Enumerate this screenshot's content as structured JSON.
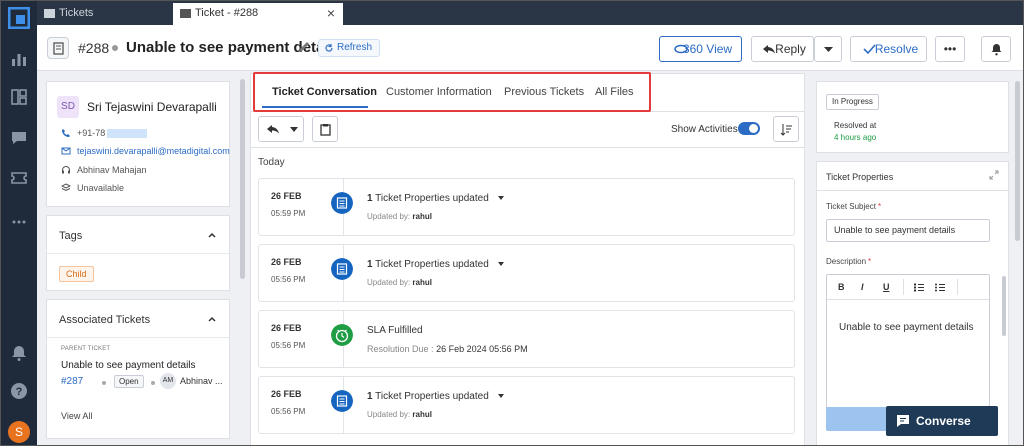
{
  "browser_tabs": [
    {
      "label": "Tickets"
    },
    {
      "label": "Ticket - #288"
    }
  ],
  "header": {
    "ticket_id": "#288",
    "title": "Unable to see payment details",
    "refresh_label": "Refresh",
    "view360_label": "360 View",
    "reply_label": "Reply",
    "resolve_label": "Resolve",
    "more_label": "•••"
  },
  "contact": {
    "initials": "SD",
    "name": "Sri Tejaswini Devarapalli",
    "phone": "+91-78",
    "email": "tejaswini.devarapalli@metadigital.com",
    "agent": "Abhinav Mahajan",
    "availability": "Unavailable"
  },
  "tags": {
    "heading": "Tags",
    "items": [
      "Child"
    ]
  },
  "associated": {
    "heading": "Associated Tickets",
    "parent_label": "PARENT TICKET",
    "title": "Unable to see payment details",
    "id": "#287",
    "status": "Open",
    "agent_initials": "AM",
    "agent_name": "Abhinav ...",
    "view_all": "View All"
  },
  "content_tabs": [
    {
      "label": "Ticket Conversation",
      "active": true
    },
    {
      "label": "Customer Information",
      "active": false
    },
    {
      "label": "Previous Tickets",
      "active": false
    },
    {
      "label": "All Files",
      "active": false
    }
  ],
  "toolbar": {
    "show_activities_label": "Show Activities",
    "show_activities_on": true
  },
  "timeline": {
    "day_label": "Today",
    "events": [
      {
        "date": "26 FEB",
        "time": "05:59 PM",
        "type": "properties",
        "count": "1",
        "title": "Ticket Properties updated",
        "sub_label": "Updated by:",
        "sub_value": "rahul"
      },
      {
        "date": "26 FEB",
        "time": "05:56 PM",
        "type": "properties",
        "count": "1",
        "title": "Ticket Properties updated",
        "sub_label": "Updated by:",
        "sub_value": "rahul"
      },
      {
        "date": "26 FEB",
        "time": "05:56 PM",
        "type": "sla",
        "count": "",
        "title": "SLA Fulfilled",
        "sub_label": "Resolution Due :",
        "sub_value": "26 Feb 2024 05:56 PM"
      },
      {
        "date": "26 FEB",
        "time": "05:56 PM",
        "type": "properties",
        "count": "1",
        "title": "Ticket Properties updated",
        "sub_label": "Updated by:",
        "sub_value": "rahul"
      }
    ]
  },
  "status_panel": {
    "status": "In Progress",
    "resolved_label": "Resolved at",
    "resolved_time": "4 hours ago"
  },
  "properties": {
    "heading": "Ticket Properties",
    "subject_label": "Ticket Subject",
    "subject_value": "Unable to see payment details",
    "description_label": "Description",
    "description_value": "Unable to see payment details",
    "editor_tools": [
      "B",
      "I",
      "U"
    ]
  },
  "converse_label": "Converse",
  "user_initial": "S",
  "colors": {
    "accent": "#2c6cc4",
    "rail": "#1f2b3a",
    "highlight_box": "#e33a3a",
    "sla_green": "#1f9d45"
  }
}
